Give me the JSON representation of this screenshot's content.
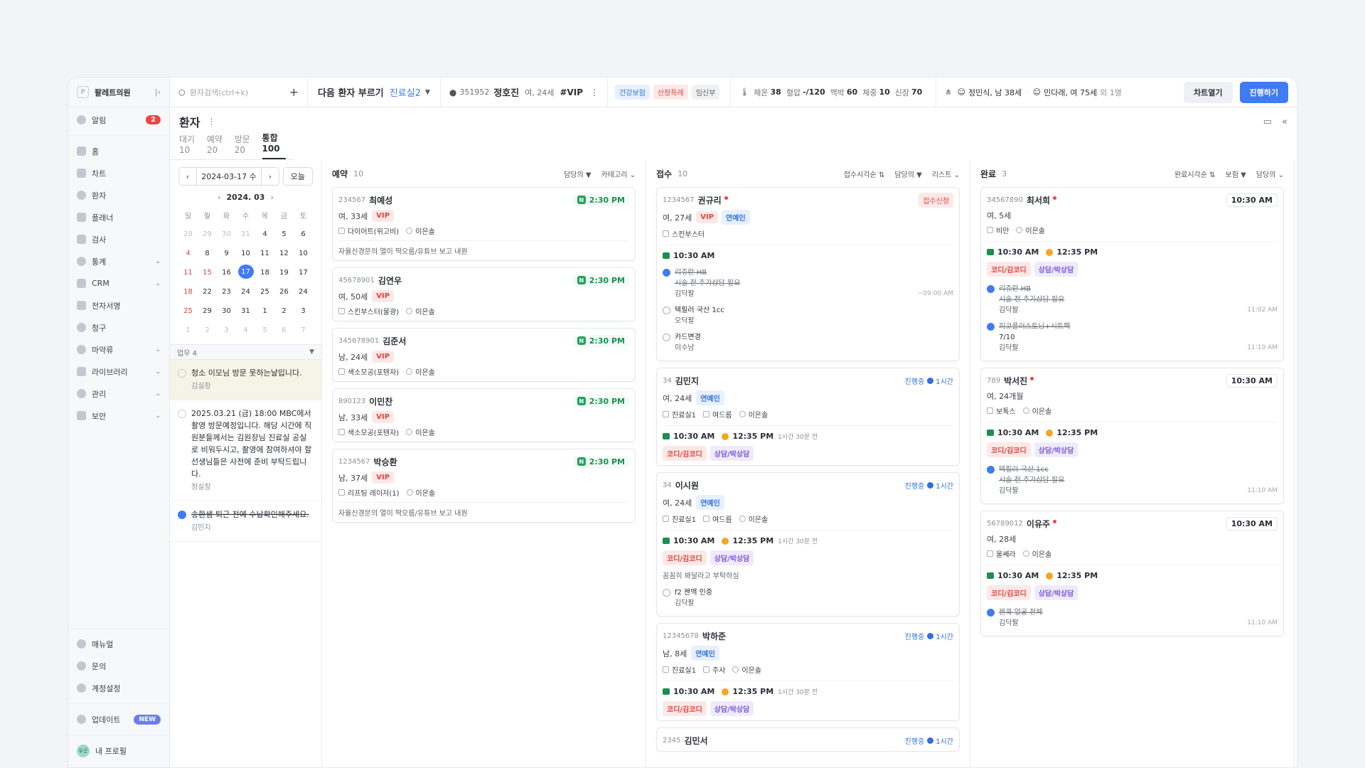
{
  "sidebar": {
    "clinic": "팔레트의원",
    "logo": "P",
    "items": [
      {
        "label": "알림",
        "badge": "2"
      },
      {
        "label": "홈"
      },
      {
        "label": "차트"
      },
      {
        "label": "환자"
      },
      {
        "label": "플래너"
      },
      {
        "label": "검사"
      },
      {
        "label": "통계"
      },
      {
        "label": "CRM"
      },
      {
        "label": "전자서명"
      },
      {
        "label": "청구"
      },
      {
        "label": "마약류"
      },
      {
        "label": "라이브러리"
      },
      {
        "label": "관리"
      },
      {
        "label": "보안"
      }
    ],
    "bottom": [
      {
        "label": "매뉴얼"
      },
      {
        "label": "문의"
      },
      {
        "label": "계정설정"
      },
      {
        "label": "업데이트",
        "badge": "NEW"
      }
    ],
    "profile": {
      "label": "내 프로필",
      "avatar": "우곤"
    }
  },
  "topbar": {
    "search_placeholder": "환자검색(ctrl+k)",
    "next_patient": "다음 환자 부르기",
    "room": "진료실2",
    "patient": {
      "id": "351952",
      "name": "정호진",
      "info": "여, 24세",
      "vip": "#VIP"
    },
    "tags": [
      "건강보험",
      "산정특례",
      "임신부"
    ],
    "vitals": [
      {
        "k": "체온",
        "v": "38"
      },
      {
        "k": "혈압",
        "v": "-/120"
      },
      {
        "k": "맥박",
        "v": "60"
      },
      {
        "k": "체중",
        "v": "10"
      },
      {
        "k": "신장",
        "v": "70"
      }
    ],
    "family": [
      "정민식, 남 38세",
      "민다래, 여 75세"
    ],
    "family_more": "외 1명",
    "chart_open": "차트열기",
    "proceed": "진행하기"
  },
  "main": {
    "title": "환자",
    "tabs": [
      "대기 10",
      "예약 20",
      "방문 20",
      "통합 100"
    ]
  },
  "calendar": {
    "date": "2024-03-17 수",
    "today": "오늘",
    "month": "2024. 03",
    "dow": [
      "일",
      "월",
      "화",
      "수",
      "목",
      "금",
      "토"
    ],
    "weeks": [
      [
        "28",
        "29",
        "30",
        "31",
        "4",
        "5",
        "6"
      ],
      [
        "4",
        "8",
        "9",
        "10",
        "11",
        "12",
        "10"
      ],
      [
        "11",
        "15",
        "16",
        "17",
        "18",
        "19",
        "17"
      ],
      [
        "18",
        "22",
        "23",
        "24",
        "25",
        "26",
        "24"
      ],
      [
        "25",
        "29",
        "30",
        "31",
        "1",
        "2",
        "3"
      ],
      [
        "1",
        "2",
        "3",
        "4",
        "5",
        "6",
        "7"
      ]
    ]
  },
  "tasks": {
    "header": "업무 4",
    "items": [
      {
        "text": "청소 이모님 방문 못하는날입니다.",
        "who": "김실장"
      },
      {
        "text": "2025.03.21 (금) 18:00 MBC에서 촬영 방문예정입니다. 해당 시간에 직원분들께서는 김원장님 진료실 공실로 비워두시고, 촬영에 참여하셔야 할 선생님들은 사전에 준비 부탁드립니다.",
        "who": "정실장"
      },
      {
        "text": "송환샘 퇴근 전에 수납확인해주세요.",
        "who": "김민지"
      }
    ]
  },
  "columns": {
    "reservation": {
      "name": "예약",
      "count": "10",
      "filters": [
        "담당의",
        "카테고리"
      ],
      "cards": [
        {
          "id": "234567",
          "name": "최예성",
          "info": "여, 33세",
          "tag": "VIP",
          "time": "2:30 PM",
          "treat": "다이어트(위고비)",
          "doctor": "이은솔",
          "memo": "자율신경문의 열이 딱오름/유튜브 보고 내원"
        },
        {
          "id": "45678901",
          "name": "김연우",
          "info": "여, 50세",
          "tag": "VIP",
          "time": "2:30 PM",
          "treat": "스킨부스터(물광)",
          "doctor": "이은솔"
        },
        {
          "id": "345678901",
          "name": "김준서",
          "info": "남, 24세",
          "tag": "VIP",
          "time": "2:30 PM",
          "treat": "색소모공(포텐자)",
          "doctor": "이은솔"
        },
        {
          "id": "890123",
          "name": "이민찬",
          "info": "남, 33세",
          "tag": "VIP",
          "time": "2:30 PM",
          "treat": "색소모공(포텐자)",
          "doctor": "이은솔"
        },
        {
          "id": "1234567",
          "name": "박승환",
          "info": "남, 37세",
          "tag": "VIP",
          "time": "2:30 PM",
          "treat": "리프팅 레이저(1)",
          "doctor": "이은솔",
          "memo": "자율신경문의 열이 딱오름/유튜브 보고 내원"
        }
      ]
    },
    "reception": {
      "name": "접수",
      "count": "10",
      "filters": [
        "접수시각순",
        "담당의",
        "리스트"
      ],
      "cards": [
        {
          "id": "1234567",
          "name": "권규리",
          "info": "여, 27세",
          "tags": [
            "VIP",
            "연예인"
          ],
          "status": "접수신청",
          "treat": "스킨부스터",
          "t1": "10:30 AM",
          "checks": [
            {
              "text": "리쥬란 HB",
              "sub": "시술 전 추가상담 필요",
              "who": "김닥팔",
              "tm": "~09:00 AM",
              "done": true
            },
            {
              "text": "텍필러 국산 1cc",
              "who": "오닥팔",
              "done": false
            },
            {
              "text": "카드변경",
              "who": "이수남",
              "done": false
            }
          ]
        },
        {
          "id": "34",
          "name": "김민지",
          "info": "여, 24세",
          "tags": [
            "연예인"
          ],
          "status": "진행중",
          "elapsed": "1시간",
          "room": "진료실1",
          "treat": "여드름",
          "doctor": "이은솔",
          "t1": "10:30 AM",
          "t2": "12:35 PM",
          "ago": "1시간 30분 전",
          "ttags": [
            "코디/김코디",
            "상담/박상담"
          ]
        },
        {
          "id": "34",
          "name": "이시원",
          "info": "여, 24세",
          "tags": [
            "연예인"
          ],
          "status": "진행중",
          "elapsed": "1시간",
          "room": "진료실1",
          "treat": "여드름",
          "doctor": "이은솔",
          "t1": "10:30 AM",
          "t2": "12:35 PM",
          "ago": "1시간 30분 전",
          "ttags": [
            "코디/김코디",
            "상담/박상담"
          ],
          "note": "꼼꼼히 봐달라고 부탁하심",
          "checks": [
            {
              "text": "f2 젠맥 인증",
              "who": "김닥팔",
              "done": false
            }
          ]
        },
        {
          "id": "12345678",
          "name": "박하준",
          "info": "남, 8세",
          "tags": [
            "연예인"
          ],
          "status": "진행중",
          "elapsed": "1시간",
          "room": "진료실1",
          "treat": "주사",
          "doctor": "이은솔",
          "t1": "10:30 AM",
          "t2": "12:35 PM",
          "ago": "1시간 30분 전",
          "ttags": [
            "코디/김코디",
            "상담/박상담"
          ]
        },
        {
          "id": "2345",
          "name": "김민서",
          "status": "진행중",
          "elapsed": "1시간"
        }
      ]
    },
    "done": {
      "name": "완료",
      "count": "3",
      "filters": [
        "완료시각순",
        "보험",
        "담당의"
      ],
      "cards": [
        {
          "id": "34567890",
          "name": "최서희",
          "info": "여, 5세",
          "time": "10:30 AM",
          "treat": "비만",
          "doctor": "이은솔",
          "t1": "10:30 AM",
          "t2": "12:35 PM",
          "ttags": [
            "코디/김코디",
            "상담/박상담"
          ],
          "checks": [
            {
              "text": "리쥬란 HB",
              "sub": "시술 전 추가상담 필요",
              "who": "김닥팔",
              "tm": "11:02 AM",
              "done": true
            },
            {
              "text": "피코플러스토닝+시트팩",
              "sub": "7/10",
              "who": "김닥팔",
              "tm": "11:10 AM",
              "done": true
            }
          ]
        },
        {
          "id": "789",
          "name": "박서진",
          "info": "여, 24개월",
          "time": "10:30 AM",
          "treat": "보톡스",
          "doctor": "이은솔",
          "t1": "10:30 AM",
          "t2": "12:35 PM",
          "ttags": [
            "코디/김코디",
            "상담/박상담"
          ],
          "checks": [
            {
              "text": "텍필러 국산 1cc",
              "sub": "시술 전 추가상담 필요",
              "who": "김닥팔",
              "tm": "11:10 AM",
              "done": true
            }
          ]
        },
        {
          "id": "56789012",
          "name": "이유주",
          "info": "여, 28세",
          "time": "10:30 AM",
          "treat": "울쎄라",
          "doctor": "이은솔",
          "t1": "10:30 AM",
          "t2": "12:35 PM",
          "ttags": [
            "코디/김코디",
            "상담/박상담"
          ],
          "checks": [
            {
              "text": "젠쿡 얼굴 전체",
              "who": "김닥팔",
              "tm": "11:10 AM",
              "done": true
            }
          ]
        }
      ]
    }
  }
}
